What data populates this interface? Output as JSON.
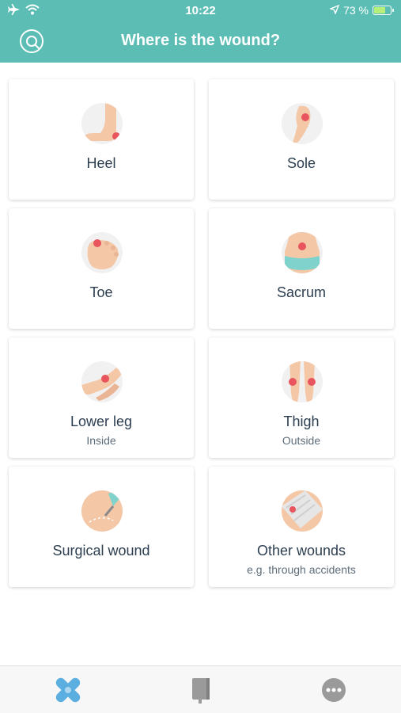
{
  "status_bar": {
    "time": "10:22",
    "battery_text": "73 %",
    "battery_level": 0.73
  },
  "header": {
    "title": "Where is the wound?",
    "search_icon": "search-icon",
    "background": "#5cbdb5"
  },
  "cards": [
    {
      "label": "Heel",
      "sublabel": "",
      "icon": "heel-icon"
    },
    {
      "label": "Sole",
      "sublabel": "",
      "icon": "sole-icon"
    },
    {
      "label": "Toe",
      "sublabel": "",
      "icon": "toe-icon"
    },
    {
      "label": "Sacrum",
      "sublabel": "",
      "icon": "sacrum-icon"
    },
    {
      "label": "Lower leg",
      "sublabel": "Inside",
      "icon": "lower-leg-icon"
    },
    {
      "label": "Thigh",
      "sublabel": "Outside",
      "icon": "thigh-icon"
    },
    {
      "label": "Surgical wound",
      "sublabel": "",
      "icon": "surgical-wound-icon"
    },
    {
      "label": "Other wounds",
      "sublabel": "e.g. through accidents",
      "icon": "other-wounds-icon"
    }
  ],
  "tabs": [
    {
      "icon": "bandage-icon",
      "active": true
    },
    {
      "icon": "notebook-icon",
      "active": false
    },
    {
      "icon": "more-icon",
      "active": false
    }
  ],
  "colors": {
    "accent": "#5cbdb5",
    "active_tab": "#5aaee0",
    "inactive_tab": "#9a9a9a",
    "wound_dot": "#e8555e",
    "skin": "#f4c7a7"
  }
}
